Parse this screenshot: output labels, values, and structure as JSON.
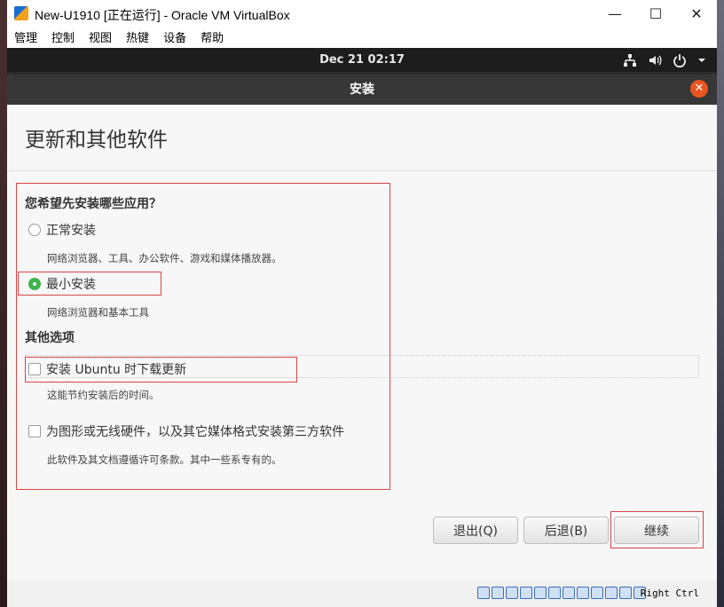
{
  "window": {
    "title": "New-U1910 [正在运行] - Oracle VM VirtualBox",
    "minimize": "—",
    "maximize": "☐",
    "close": "✕"
  },
  "menu": [
    "管理",
    "控制",
    "视图",
    "热键",
    "设备",
    "帮助"
  ],
  "guest_panel": {
    "clock": "Dec 21  02:17",
    "icons": [
      "network-icon",
      "volume-icon",
      "power-icon",
      "chevron-down-icon"
    ]
  },
  "installer": {
    "header_title": "安装",
    "close_icon": "close-icon",
    "page_title": "更新和其他软件",
    "question": "您希望先安装哪些应用？",
    "normal_install": {
      "label": "正常安装",
      "desc": "网络浏览器、工具、办公软件、游戏和媒体播放器。",
      "selected": false
    },
    "minimal_install": {
      "label": "最小安装",
      "desc": "网络浏览器和基本工具",
      "selected": true
    },
    "other_options": "其他选项",
    "download_updates": {
      "label": "安装 Ubuntu 时下载更新",
      "desc": "这能节约安装后的时间。",
      "checked": false
    },
    "third_party": {
      "label": "为图形或无线硬件，以及其它媒体格式安装第三方软件",
      "desc": "此软件及其文档遵循许可条款。其中一些系专有的。",
      "checked": false
    },
    "buttons": {
      "quit": "退出(Q)",
      "back": "后退(B)",
      "continue": "继续"
    }
  },
  "statusbar": {
    "host_key": "Right Ctrl"
  },
  "colors": {
    "accent_orange": "#e95420",
    "radio_green": "#3eb34f",
    "highlight_red": "#d64545"
  }
}
